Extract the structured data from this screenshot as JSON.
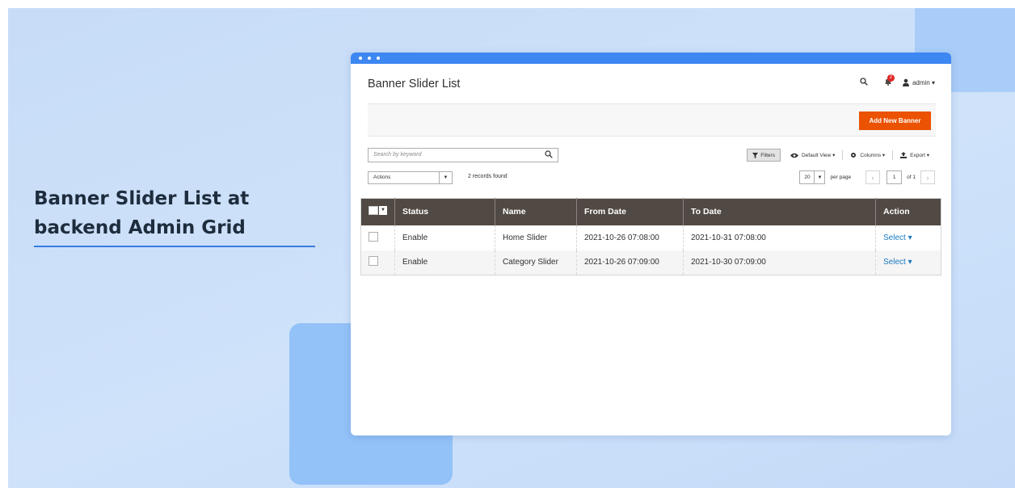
{
  "headline": {
    "line1": "Banner Slider List at",
    "line2": "backend Admin Grid"
  },
  "admin": {
    "page_title": "Banner Slider List",
    "notification_count": "2",
    "user_label": "admin ▾",
    "add_button": "Add New Banner",
    "search_placeholder": "Search by keyword",
    "filters_label": "Filters",
    "default_view_label": "Default View ▾",
    "columns_label": "Columns ▾",
    "export_label": "Export ▾",
    "actions_select": "Actions",
    "records_found": "2 records found",
    "per_page_value": "20",
    "per_page_label": "per page",
    "current_page": "1",
    "of_pages": "of 1",
    "columns": [
      "Status",
      "Name",
      "From Date",
      "To Date",
      "Action"
    ],
    "rows": [
      {
        "status": "Enable",
        "name": "Home Slider",
        "from_date": "2021-10-26 07:08:00",
        "to_date": "2021-10-31 07:08:00",
        "action": "Select ▾"
      },
      {
        "status": "Enable",
        "name": "Category Slider",
        "from_date": "2021-10-26 07:09:00",
        "to_date": "2021-10-30 07:09:00",
        "action": "Select ▾"
      }
    ]
  },
  "colors": {
    "accent_orange": "#eb5202",
    "header_dark": "#514943",
    "window_bar": "#3d87f2",
    "link_blue": "#1979c3"
  },
  "icons": [
    "search-icon",
    "bell-icon",
    "user-icon",
    "filter-icon",
    "eye-icon",
    "gear-icon",
    "export-icon",
    "chevron-down-icon",
    "chevron-left-icon",
    "chevron-right-icon"
  ]
}
